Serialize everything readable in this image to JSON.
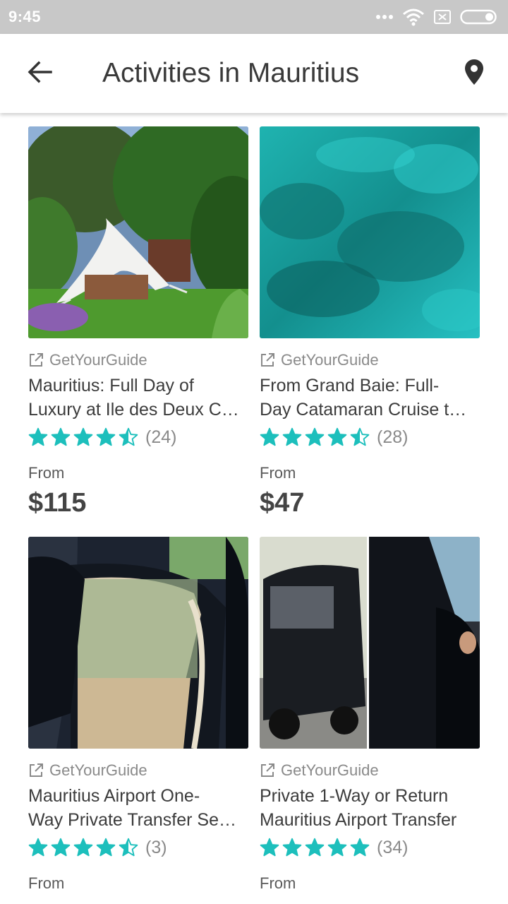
{
  "status_bar": {
    "time": "9:45",
    "icons": [
      "signal-dots-icon",
      "wifi-icon",
      "sim-icon",
      "battery-icon"
    ]
  },
  "app_bar": {
    "title": "Activities in Mauritius",
    "back_icon": "arrow-left-icon",
    "map_icon": "location-pin-icon"
  },
  "accent_color": "#1dbfbc",
  "cards": [
    {
      "provider": "GetYourGuide",
      "title": "Mauritius: Full Day of Luxury at Ile des Deux C…",
      "title_line1": "Mauritius: Full Day of",
      "title_line2": "Luxury at Ile des Deux C…",
      "rating": 4.5,
      "rating_count": "(24)",
      "from_label": "From",
      "price": "$115",
      "image": "tent-garden-photo"
    },
    {
      "provider": "GetYourGuide",
      "title": "From Grand Baie: Full-Day Catamaran Cruise t…",
      "title_line1": "From Grand Baie: Full-",
      "title_line2": "Day Catamaran Cruise t…",
      "rating": 4.5,
      "rating_count": "(28)",
      "from_label": "From",
      "price": "$47",
      "image": "turquoise-water-photo"
    },
    {
      "provider": "GetYourGuide",
      "title": "Mauritius Airport One-Way Private Transfer Se…",
      "title_line1": "Mauritius Airport One-",
      "title_line2": "Way Private Transfer Se…",
      "rating": 4.5,
      "rating_count": "(3)",
      "from_label": "From",
      "image": "car-door-interior-photo"
    },
    {
      "provider": "GetYourGuide",
      "title": "Private 1-Way or Return Mauritius Airport Transfer",
      "title_line1": "Private 1-Way or Return",
      "title_line2": "Mauritius Airport Transfer",
      "rating": 5,
      "rating_count": "(34)",
      "from_label": "From",
      "image": "black-cars-photo"
    }
  ]
}
